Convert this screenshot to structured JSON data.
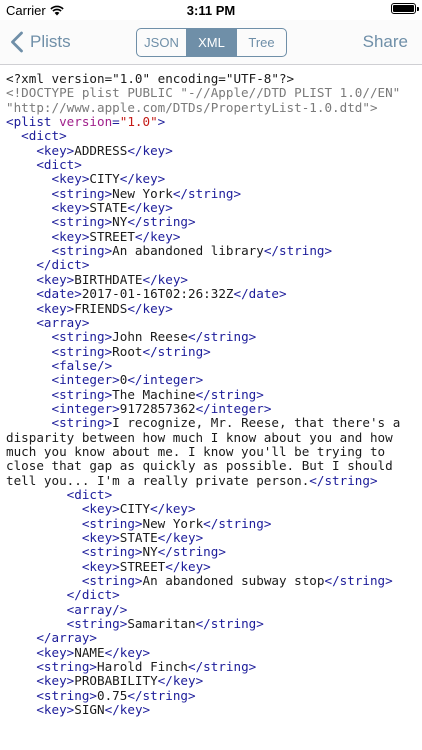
{
  "status": {
    "carrier": "Carrier",
    "time": "3:11 PM",
    "battery_level_percent": 100
  },
  "nav": {
    "back_label": "Plists",
    "segments": [
      {
        "label": "JSON",
        "selected": false
      },
      {
        "label": "XML",
        "selected": true
      },
      {
        "label": "Tree",
        "selected": false
      }
    ],
    "share_label": "Share"
  },
  "colors": {
    "accent": "#6f8fa8",
    "tag": "#1c1c9a",
    "attribute": "#a0208b",
    "attribute_value": "#c41a16",
    "doctype": "#7a7a7a"
  },
  "code_lines": [
    {
      "indent": "",
      "parts": [
        [
          "decl",
          "<?xml version=\"1.0\" encoding=\"UTF-8\"?>"
        ]
      ]
    },
    {
      "indent": "",
      "parts": [
        [
          "doctype",
          "<!DOCTYPE plist PUBLIC \"-//Apple//DTD PLIST 1.0//EN\" \"http://www.apple.com/DTDs/PropertyList-1.0.dtd\">"
        ]
      ]
    },
    {
      "indent": "",
      "parts": [
        [
          "tag",
          "<plist "
        ],
        [
          "attr",
          "version"
        ],
        [
          "tag",
          "="
        ],
        [
          "val",
          "\"1.0\""
        ],
        [
          "tag",
          ">"
        ]
      ]
    },
    {
      "indent": "  ",
      "parts": [
        [
          "tag",
          "<dict>"
        ]
      ]
    },
    {
      "indent": "    ",
      "parts": [
        [
          "tag",
          "<key>"
        ],
        [
          "text",
          "ADDRESS"
        ],
        [
          "tag",
          "</key>"
        ]
      ]
    },
    {
      "indent": "    ",
      "parts": [
        [
          "tag",
          "<dict>"
        ]
      ]
    },
    {
      "indent": "      ",
      "parts": [
        [
          "tag",
          "<key>"
        ],
        [
          "text",
          "CITY"
        ],
        [
          "tag",
          "</key>"
        ]
      ]
    },
    {
      "indent": "      ",
      "parts": [
        [
          "tag",
          "<string>"
        ],
        [
          "text",
          "New York"
        ],
        [
          "tag",
          "</string>"
        ]
      ]
    },
    {
      "indent": "      ",
      "parts": [
        [
          "tag",
          "<key>"
        ],
        [
          "text",
          "STATE"
        ],
        [
          "tag",
          "</key>"
        ]
      ]
    },
    {
      "indent": "      ",
      "parts": [
        [
          "tag",
          "<string>"
        ],
        [
          "text",
          "NY"
        ],
        [
          "tag",
          "</string>"
        ]
      ]
    },
    {
      "indent": "      ",
      "parts": [
        [
          "tag",
          "<key>"
        ],
        [
          "text",
          "STREET"
        ],
        [
          "tag",
          "</key>"
        ]
      ]
    },
    {
      "indent": "      ",
      "parts": [
        [
          "tag",
          "<string>"
        ],
        [
          "text",
          "An abandoned library"
        ],
        [
          "tag",
          "</string>"
        ]
      ]
    },
    {
      "indent": "    ",
      "parts": [
        [
          "tag",
          "</dict>"
        ]
      ]
    },
    {
      "indent": "    ",
      "parts": [
        [
          "tag",
          "<key>"
        ],
        [
          "text",
          "BIRTHDATE"
        ],
        [
          "tag",
          "</key>"
        ]
      ]
    },
    {
      "indent": "    ",
      "parts": [
        [
          "tag",
          "<date>"
        ],
        [
          "text",
          "2017-01-16T02:26:32Z"
        ],
        [
          "tag",
          "</date>"
        ]
      ]
    },
    {
      "indent": "    ",
      "parts": [
        [
          "tag",
          "<key>"
        ],
        [
          "text",
          "FRIENDS"
        ],
        [
          "tag",
          "</key>"
        ]
      ]
    },
    {
      "indent": "    ",
      "parts": [
        [
          "tag",
          "<array>"
        ]
      ]
    },
    {
      "indent": "      ",
      "parts": [
        [
          "tag",
          "<string>"
        ],
        [
          "text",
          "John Reese"
        ],
        [
          "tag",
          "</string>"
        ]
      ]
    },
    {
      "indent": "      ",
      "parts": [
        [
          "tag",
          "<string>"
        ],
        [
          "text",
          "Root"
        ],
        [
          "tag",
          "</string>"
        ]
      ]
    },
    {
      "indent": "      ",
      "parts": [
        [
          "tag",
          "<false/>"
        ]
      ]
    },
    {
      "indent": "      ",
      "parts": [
        [
          "tag",
          "<integer>"
        ],
        [
          "text",
          "0"
        ],
        [
          "tag",
          "</integer>"
        ]
      ]
    },
    {
      "indent": "      ",
      "parts": [
        [
          "tag",
          "<string>"
        ],
        [
          "text",
          "The Machine"
        ],
        [
          "tag",
          "</string>"
        ]
      ]
    },
    {
      "indent": "      ",
      "parts": [
        [
          "tag",
          "<integer>"
        ],
        [
          "text",
          "9172857362"
        ],
        [
          "tag",
          "</integer>"
        ]
      ]
    },
    {
      "indent": "      ",
      "parts": [
        [
          "tag",
          "<string>"
        ],
        [
          "text",
          "I recognize, Mr. Reese, that there's a disparity between how much I know about you and how much you know about me. I know you'll be trying to close that gap as quickly as possible. But I should tell you... I'm a really private person."
        ],
        [
          "tag",
          "</string>"
        ]
      ]
    },
    {
      "indent": "        ",
      "parts": [
        [
          "tag",
          "<dict>"
        ]
      ]
    },
    {
      "indent": "          ",
      "parts": [
        [
          "tag",
          "<key>"
        ],
        [
          "text",
          "CITY"
        ],
        [
          "tag",
          "</key>"
        ]
      ]
    },
    {
      "indent": "          ",
      "parts": [
        [
          "tag",
          "<string>"
        ],
        [
          "text",
          "New York"
        ],
        [
          "tag",
          "</string>"
        ]
      ]
    },
    {
      "indent": "          ",
      "parts": [
        [
          "tag",
          "<key>"
        ],
        [
          "text",
          "STATE"
        ],
        [
          "tag",
          "</key>"
        ]
      ]
    },
    {
      "indent": "          ",
      "parts": [
        [
          "tag",
          "<string>"
        ],
        [
          "text",
          "NY"
        ],
        [
          "tag",
          "</string>"
        ]
      ]
    },
    {
      "indent": "          ",
      "parts": [
        [
          "tag",
          "<key>"
        ],
        [
          "text",
          "STREET"
        ],
        [
          "tag",
          "</key>"
        ]
      ]
    },
    {
      "indent": "          ",
      "parts": [
        [
          "tag",
          "<string>"
        ],
        [
          "text",
          "An abandoned subway stop"
        ],
        [
          "tag",
          "</string>"
        ]
      ]
    },
    {
      "indent": "        ",
      "parts": [
        [
          "tag",
          "</dict>"
        ]
      ]
    },
    {
      "indent": "        ",
      "parts": [
        [
          "tag",
          "<array/>"
        ]
      ]
    },
    {
      "indent": "        ",
      "parts": [
        [
          "tag",
          "<string>"
        ],
        [
          "text",
          "Samaritan"
        ],
        [
          "tag",
          "</string>"
        ]
      ]
    },
    {
      "indent": "    ",
      "parts": [
        [
          "tag",
          "</array>"
        ]
      ]
    },
    {
      "indent": "    ",
      "parts": [
        [
          "tag",
          "<key>"
        ],
        [
          "text",
          "NAME"
        ],
        [
          "tag",
          "</key>"
        ]
      ]
    },
    {
      "indent": "    ",
      "parts": [
        [
          "tag",
          "<string>"
        ],
        [
          "text",
          "Harold Finch"
        ],
        [
          "tag",
          "</string>"
        ]
      ]
    },
    {
      "indent": "    ",
      "parts": [
        [
          "tag",
          "<key>"
        ],
        [
          "text",
          "PROBABILITY"
        ],
        [
          "tag",
          "</key>"
        ]
      ]
    },
    {
      "indent": "    ",
      "parts": [
        [
          "tag",
          "<string>"
        ],
        [
          "text",
          "0.75"
        ],
        [
          "tag",
          "</string>"
        ]
      ]
    },
    {
      "indent": "    ",
      "parts": [
        [
          "tag",
          "<key>"
        ],
        [
          "text",
          "SIGN"
        ],
        [
          "tag",
          "</key>"
        ]
      ]
    }
  ]
}
